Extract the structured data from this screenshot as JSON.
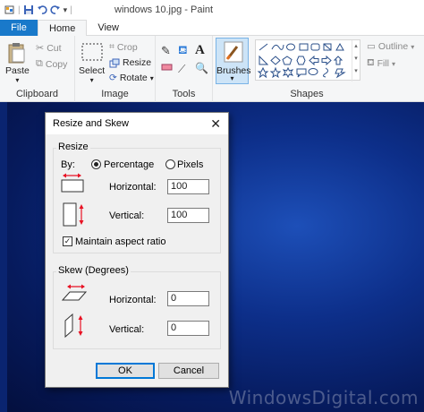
{
  "window": {
    "title": "windows 10.jpg - Paint"
  },
  "tabs": [
    "File",
    "Home",
    "View"
  ],
  "ribbon": {
    "clipboard": {
      "paste": "Paste",
      "cut": "Cut",
      "copy": "Copy",
      "label": "Clipboard"
    },
    "image": {
      "select": "Select",
      "crop": "Crop",
      "resize": "Resize",
      "rotate": "Rotate",
      "label": "Image"
    },
    "tools": {
      "label": "Tools"
    },
    "brushes": {
      "label": "Brushes"
    },
    "shapes": {
      "outline": "Outline",
      "fill": "Fill",
      "label": "Shapes"
    }
  },
  "dialog": {
    "title": "Resize and Skew",
    "resize": {
      "legend": "Resize",
      "by": "By:",
      "percentage": "Percentage",
      "pixels": "Pixels",
      "horizontal_label": "Horizontal:",
      "horizontal_value": "100",
      "vertical_label": "Vertical:",
      "vertical_value": "100",
      "maintain": "Maintain aspect ratio",
      "maintain_checked": true,
      "unit_selected": "Percentage"
    },
    "skew": {
      "legend": "Skew (Degrees)",
      "horizontal_label": "Horizontal:",
      "horizontal_value": "0",
      "vertical_label": "Vertical:",
      "vertical_value": "0"
    },
    "ok": "OK",
    "cancel": "Cancel"
  },
  "watermark": "WindowsDigital.com",
  "colors": {
    "file_tab": "#1979ca",
    "accent": "#0078d7",
    "canvas": "#0d2f8a",
    "arrow_red": "#e81123"
  }
}
